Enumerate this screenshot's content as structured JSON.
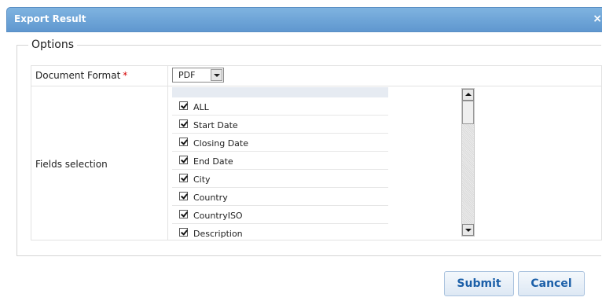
{
  "dialog": {
    "title": "Export Result",
    "close_glyph": "×"
  },
  "options": {
    "legend": "Options",
    "document_format": {
      "label": "Document Format",
      "required_mark": "*",
      "selected": "PDF"
    },
    "fields_selection": {
      "label": "Fields selection",
      "items": [
        {
          "label": "ALL",
          "checked": true
        },
        {
          "label": "Start Date",
          "checked": true
        },
        {
          "label": "Closing Date",
          "checked": true
        },
        {
          "label": "End Date",
          "checked": true
        },
        {
          "label": "City",
          "checked": true
        },
        {
          "label": "Country",
          "checked": true
        },
        {
          "label": "CountryISO",
          "checked": true
        },
        {
          "label": "Description",
          "checked": true
        }
      ]
    }
  },
  "buttons": {
    "submit": "Submit",
    "cancel": "Cancel"
  },
  "colors": {
    "titlebar": "#6aa3d8",
    "button_text": "#1b5fa8",
    "required": "#d40000"
  },
  "icons": {
    "close": "close-icon",
    "dropdown": "chevron-down-icon",
    "checkbox": "checkbox-checked-icon"
  }
}
